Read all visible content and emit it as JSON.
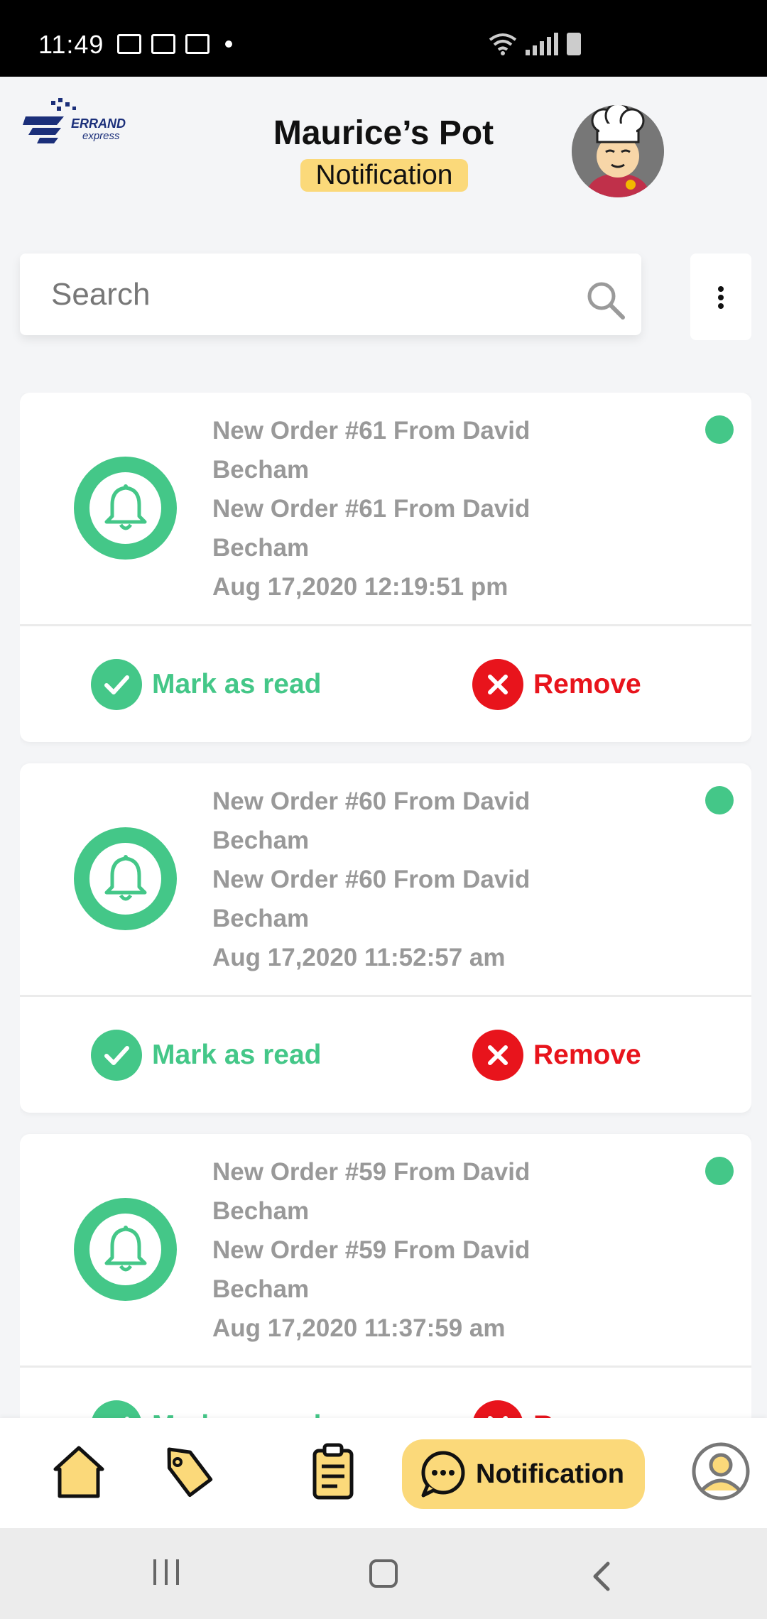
{
  "status_bar": {
    "time": "11:49"
  },
  "header": {
    "logo_text": "ERRAND express",
    "store_name": "Maurice’s Pot",
    "page_badge": "Notification"
  },
  "search": {
    "placeholder": "Search",
    "value": ""
  },
  "notifications": [
    {
      "title_1": "New Order #61 From David Becham",
      "title_2": "New Order #61 From David Becham",
      "timestamp": "Aug 17,2020 12:19:51 pm",
      "mark_label": "Mark as read",
      "remove_label": "Remove"
    },
    {
      "title_1": "New Order #60 From David Becham",
      "title_2": "New Order #60 From David Becham",
      "timestamp": "Aug 17,2020 11:52:57 am",
      "mark_label": "Mark as read",
      "remove_label": "Remove"
    },
    {
      "title_1": "New Order #59 From David Becham",
      "title_2": "New Order #59 From David Becham",
      "timestamp": "Aug 17,2020 11:37:59 am",
      "mark_label": "Mark as read",
      "remove_label": "Remove"
    }
  ],
  "bottom_nav": {
    "items": [
      "home-icon",
      "tag-icon",
      "clipboard-icon",
      "chat-icon",
      "profile-icon"
    ],
    "active_label": "Notification"
  },
  "colors": {
    "accent_green": "#44c788",
    "danger_red": "#e8141c",
    "highlight_yellow": "#fbd97a"
  }
}
